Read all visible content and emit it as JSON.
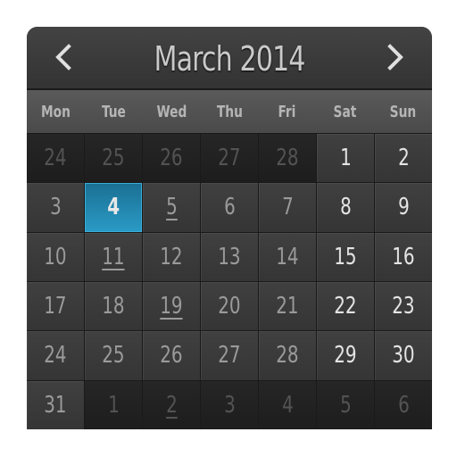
{
  "header": {
    "title": "March 2014",
    "prev_icon": "chevron-left-icon",
    "next_icon": "chevron-right-icon"
  },
  "weekdays": [
    "Mon",
    "Tue",
    "Wed",
    "Thu",
    "Fri",
    "Sat",
    "Sun"
  ],
  "colors": {
    "selected": "#2a9bc6"
  },
  "weeks": [
    [
      {
        "d": "24",
        "t": "other"
      },
      {
        "d": "25",
        "t": "other"
      },
      {
        "d": "26",
        "t": "other"
      },
      {
        "d": "27",
        "t": "other"
      },
      {
        "d": "28",
        "t": "other"
      },
      {
        "d": "1",
        "t": "weekend"
      },
      {
        "d": "2",
        "t": "weekend"
      }
    ],
    [
      {
        "d": "3",
        "t": "current"
      },
      {
        "d": "4",
        "t": "selected"
      },
      {
        "d": "5",
        "t": "current",
        "event": true
      },
      {
        "d": "6",
        "t": "current"
      },
      {
        "d": "7",
        "t": "current"
      },
      {
        "d": "8",
        "t": "weekend"
      },
      {
        "d": "9",
        "t": "weekend"
      }
    ],
    [
      {
        "d": "10",
        "t": "current"
      },
      {
        "d": "11",
        "t": "current",
        "event": true
      },
      {
        "d": "12",
        "t": "current"
      },
      {
        "d": "13",
        "t": "current"
      },
      {
        "d": "14",
        "t": "current"
      },
      {
        "d": "15",
        "t": "weekend"
      },
      {
        "d": "16",
        "t": "weekend"
      }
    ],
    [
      {
        "d": "17",
        "t": "current"
      },
      {
        "d": "18",
        "t": "current"
      },
      {
        "d": "19",
        "t": "current",
        "event": true
      },
      {
        "d": "20",
        "t": "current"
      },
      {
        "d": "21",
        "t": "current"
      },
      {
        "d": "22",
        "t": "weekend"
      },
      {
        "d": "23",
        "t": "weekend"
      }
    ],
    [
      {
        "d": "24",
        "t": "current"
      },
      {
        "d": "25",
        "t": "current"
      },
      {
        "d": "26",
        "t": "current"
      },
      {
        "d": "27",
        "t": "current"
      },
      {
        "d": "28",
        "t": "current"
      },
      {
        "d": "29",
        "t": "weekend"
      },
      {
        "d": "30",
        "t": "weekend"
      }
    ],
    [
      {
        "d": "31",
        "t": "current"
      },
      {
        "d": "1",
        "t": "other"
      },
      {
        "d": "2",
        "t": "other",
        "event": true
      },
      {
        "d": "3",
        "t": "other"
      },
      {
        "d": "4",
        "t": "other"
      },
      {
        "d": "5",
        "t": "other"
      },
      {
        "d": "6",
        "t": "other"
      }
    ]
  ]
}
